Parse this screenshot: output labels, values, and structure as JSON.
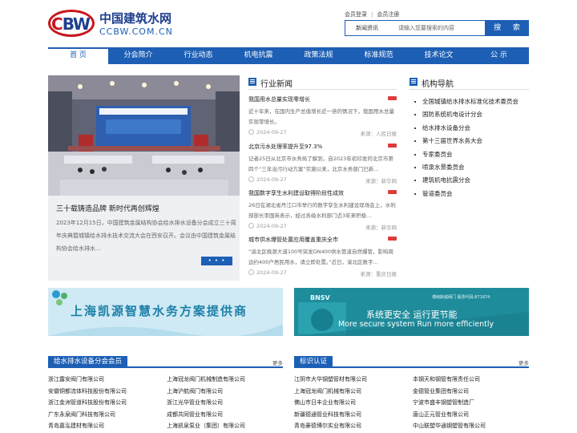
{
  "logo": {
    "mark": "CBW",
    "mark_c": "C",
    "mark_bw": "BW",
    "cn": "中国建筑水网",
    "en": "CCBW.COM.CN"
  },
  "member_links": {
    "login": "会员登录",
    "register": "会员注册"
  },
  "search": {
    "category": "新闻资讯",
    "placeholder": "请输入您要搜索的内容",
    "button": "搜 索"
  },
  "nav": [
    "首 页",
    "分会简介",
    "行业动态",
    "机电抗震",
    "政策法规",
    "标准规范",
    "技术论文",
    "公 示"
  ],
  "feature": {
    "title": "三十载铸造品牌 新时代再创辉煌",
    "text": "2023年12月15日，中国建筑金属结构协会给水排水设备分会成立三十周年庆典暨城镇给水排水技术交流大会在西安召开。会议由中国建筑金属结构协会给水排水...",
    "more": "• • •"
  },
  "news": {
    "heading": "行业新闻",
    "items": [
      {
        "title": "我国用水总量实现零增长",
        "summary": "近十年来，在国内生产总值增长近一倍的情况下，我国用水总量实现零增长。",
        "date": "2024-09-27",
        "source": "来源：人民日报"
      },
      {
        "title": "北京污水处理率提升至97.3%",
        "summary": "记者25日从北京市水务局了解到，自2023年初印发的北京市第四个“三年治污行动方案”实施以来，北京水务部门已新...",
        "date": "2024-09-27",
        "source": "来源：新华网"
      },
      {
        "title": "我国数字孪生水利建设取得阶段性成效",
        "summary": "26日在湖北省丹江口市举行的数字孪生水利建设现场会上，水利部部长李国英表示，经过各级水利部门近3年来积极...",
        "date": "2024-09-27",
        "source": "来源：新华网"
      },
      {
        "title": "城市供水爆管处置应用覆盖重庆全市",
        "summary": "“渝北区桃源大道100号突发DN400供水管道自然爆管，影响周边约400户居民用水，请立即处置。”近日，渝北区数字...",
        "date": "2024-09-27",
        "source": "来源：重庆日报"
      }
    ]
  },
  "orgs": {
    "heading": "机构导航",
    "items": [
      "全国城镇给水排水标准化技术委员会",
      "国防系统机电设计分会",
      "给水排水设备分会",
      "第十三届世界水务大会",
      "专家委员会",
      "喷泉水景委员会",
      "建筑机电抗震分会",
      "管道委员会"
    ]
  },
  "banner1": {
    "text": "上海凯源智慧水务方案提供商"
  },
  "banner2": {
    "brand": "BNSV",
    "small": "博纳斯威阀门  股票代码:871874",
    "cn": "系统更安全 运行更节能",
    "en": "More secure system  Run more efficiently"
  },
  "members": {
    "tab": "给水排水设备分会会员",
    "more": "更多",
    "rows": [
      "浙江露安阀门有限公司",
      "上海冠龙阀门机械制造有限公司",
      "安徽铜都流体科技股份有限公司",
      "上海沪航阀门有限公司",
      "浙江金洲管道科技股份有限公司",
      "浙江光华管业有限公司",
      "广东永泉阀门科技有限公司",
      "成都共同管业有限公司",
      "青岛嘉泓建材有限公司",
      "上海凯泉泵业（集团）有限公司"
    ]
  },
  "brands": {
    "tab": "标识认证",
    "more": "更多",
    "rows": [
      "江阴市大华钢塑管材有限公司",
      "本钢天和钢管有限责任公司",
      "上海冠龙阀门机械有限公司",
      "金德管业集团有限公司",
      "佛山市日丰企业有限公司",
      "宁波市盛丰钢塑管制造厂",
      "新疆德通管业科技有限公司",
      "唐山正元管业有限公司",
      "青岛豪德博尔实业有限公司",
      "中山联塑华通钢塑管有限公司"
    ]
  }
}
